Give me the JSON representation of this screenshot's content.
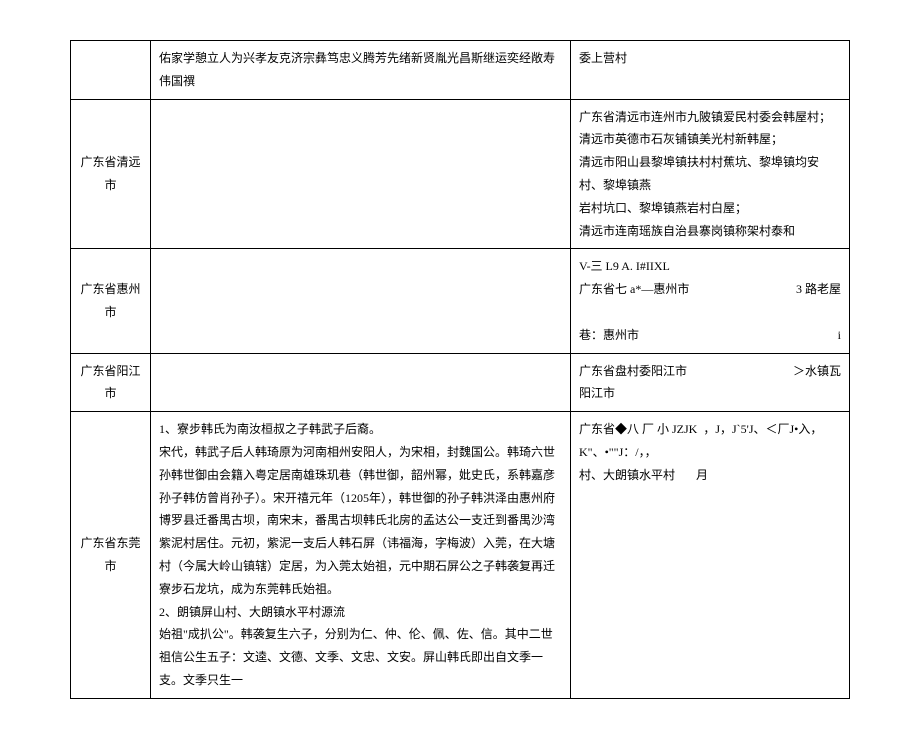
{
  "rows": [
    {
      "col1": "",
      "col2": "佑家学憩立人为兴孝友克济宗彝笃忠义腾芳先绪新贤胤光昌斯继运奕经敞寿伟国禩",
      "col3": "委上营村"
    },
    {
      "col1": "广东省清远市",
      "col2": "",
      "col3_lines": [
        "广东省清远市连州市九陂镇爱民村委会韩屋村；",
        "清远市英德市石灰铺镇美光村新韩屋；",
        "清远市阳山县黎埠镇扶村村蕉坑、黎埠镇均安村、黎埠镇燕",
        "岩村坑口、黎埠镇燕岩村白屋；",
        "清远市连南瑶族自治县寨岗镇称架村泰和"
      ]
    },
    {
      "col1": "广东省惠州市",
      "col2": "",
      "col3_html": "V-三 L9 A. I#IIXL<br>广东省七 a*—惠州市<span class=\"inline-right\">3 路老屋</span><br><br>巷：惠州市<span class=\"inline-right\">i</span>"
    },
    {
      "col1": "广东省阳江市",
      "col2": "",
      "col3_html": "广东省盘村委阳江市<span class=\"inline-right\">＞水镇瓦</span><br>阳江市"
    },
    {
      "col1": "广东省东莞市",
      "col2_lines": [
        "1、寮步韩氏为南汝桓叔之子韩武子后裔。",
        "宋代，韩武子后人韩琦原为河南相州安阳人，为宋相，封魏国公。韩琦六世孙韩世御由会籍入粤定居南雄珠玑巷（韩世御，韶州幂，妣史氏，系韩嘉彦孙子韩仿曾肖孙子）。宋开禧元年（1205年），韩世御的孙子韩洪泽由惠州府博罗县迁番禺古坝，南宋末，番禺古坝韩氏北房的孟达公一支迁到番禺沙湾紫泥村居住。元初，紫泥一支后人韩石屏（讳福海，字梅波）入莞，在大塘村（今属大岭山镇辖）定居，为入莞太始祖，元中期石屏公之子韩袭复再迁寮步石龙坑，成为东莞韩氏始祖。",
        "2、朗镇屏山村、大朗镇水平村源流",
        "始祖\"成扒公\"。韩袭复生六子，分别为仁、仲、伦、佩、佐、信。其中二世祖信公生五子：文逵、文德、文季、文忠、文安。屏山韩氏即出自文季一支。文季只生一"
      ],
      "col3_html": "广东省◆八 厂 小 JZJK&nbsp;&nbsp;，J，J`5'J、＜厂J•入，K\"、•\"\"J：/，，<br>村、大朗镇水平村&nbsp;&nbsp;&nbsp;&nbsp;&nbsp;&nbsp;&nbsp;月"
    }
  ]
}
